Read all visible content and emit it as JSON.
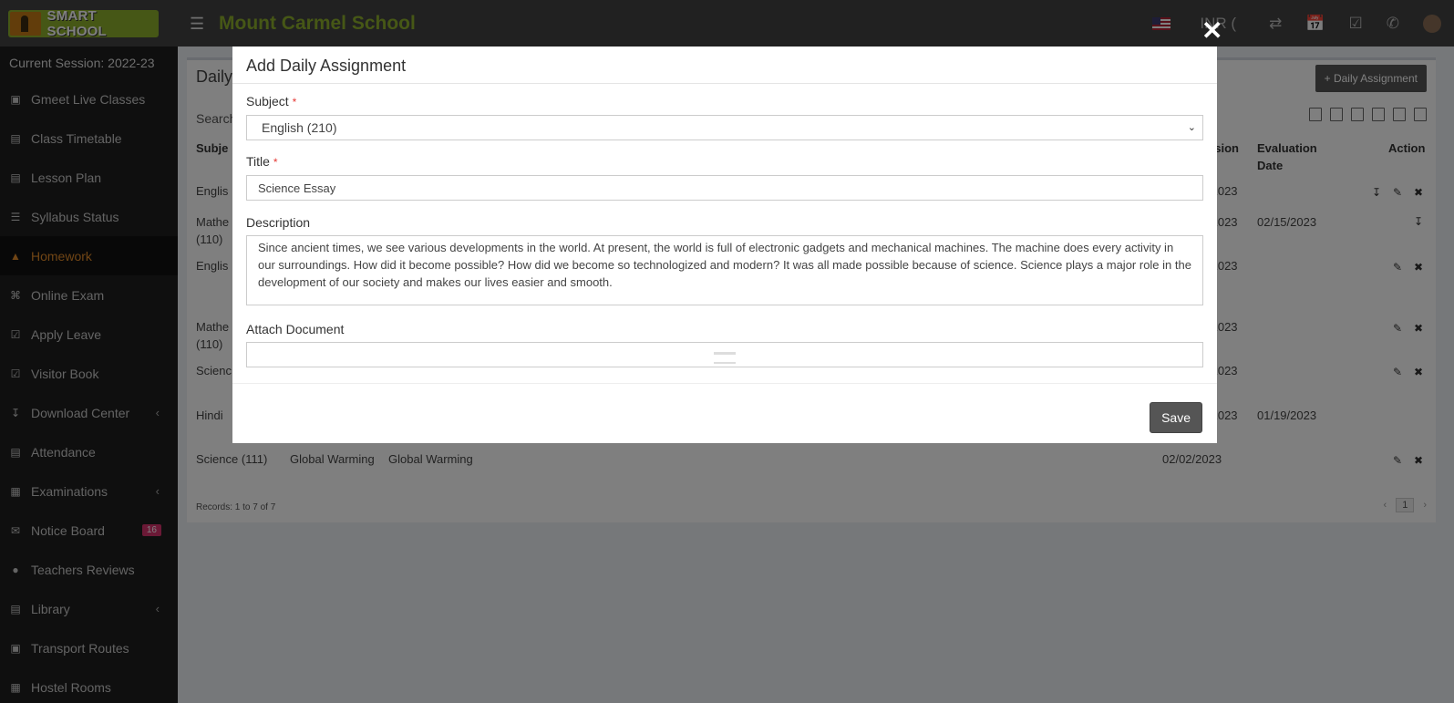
{
  "topbar": {
    "logo_text": "SMART SCHOOL",
    "school_name": "Mount Carmel School",
    "currency": "INR (",
    "icons": [
      "menu-icon",
      "flag-icon",
      "exchange-icon",
      "calendar-icon",
      "check-square-icon",
      "whatsapp-icon",
      "avatar-icon"
    ]
  },
  "sidebar": {
    "session": "Current Session: 2022-23",
    "items": [
      {
        "label": "Gmeet Live Classes",
        "icon": "video-icon"
      },
      {
        "label": "Class Timetable",
        "icon": "calendar-plus-icon"
      },
      {
        "label": "Lesson Plan",
        "icon": "list-alt-icon"
      },
      {
        "label": "Syllabus Status",
        "icon": "list-icon"
      },
      {
        "label": "Homework",
        "icon": "flask-icon"
      },
      {
        "label": "Online Exam",
        "icon": "rss-icon"
      },
      {
        "label": "Apply Leave",
        "icon": "check-square-icon"
      },
      {
        "label": "Visitor Book",
        "icon": "check-square-icon"
      },
      {
        "label": "Download Center",
        "icon": "download-icon"
      },
      {
        "label": "Attendance",
        "icon": "calendar-check-icon"
      },
      {
        "label": "Examinations",
        "icon": "map-icon"
      },
      {
        "label": "Notice Board",
        "icon": "envelope-icon",
        "badge": "16"
      },
      {
        "label": "Teachers Reviews",
        "icon": "user-secret-icon"
      },
      {
        "label": "Library",
        "icon": "book-icon"
      },
      {
        "label": "Transport Routes",
        "icon": "bus-icon"
      },
      {
        "label": "Hostel Rooms",
        "icon": "building-icon"
      }
    ],
    "active_index": 4
  },
  "page": {
    "title": "Daily",
    "add_button": "+ Daily Assignment",
    "search_label": "Search",
    "headers": {
      "subject": "Subje",
      "submission": "ssion",
      "evaluation": "Evaluation",
      "evaluation2": "Date",
      "action": "Action"
    },
    "rows": [
      {
        "subject": "Englis",
        "date": "/2023",
        "eval": ""
      },
      {
        "subject": "Mathe",
        "subject2": "(110)",
        "date": "/2023",
        "eval": "02/15/2023"
      },
      {
        "subject": "Englis",
        "date": "/2023",
        "eval": ""
      },
      {
        "subject": "Mathe",
        "subject2": "(110)",
        "date": "/2023",
        "eval": ""
      },
      {
        "subject": "Scienc",
        "date": "/2023",
        "eval": ""
      },
      {
        "subject": "Hindi",
        "date": "/2023",
        "eval": "01/19/2023"
      },
      {
        "subject": "Science (111)",
        "title": "Global Warming",
        "description": "Global Warming",
        "date": "02/02/2023",
        "eval": ""
      }
    ],
    "records": "Records: 1 to 7 of 7",
    "page_num": "1"
  },
  "modal": {
    "title": "Add Daily Assignment",
    "subject_label": "Subject",
    "subject_value": "English (210)",
    "title_label": "Title",
    "title_value": "Science Essay",
    "description_label": "Description",
    "description_value": "Since ancient times, we see various developments in the world. At present, the world is full of electronic gadgets and mechanical machines. The machine does every activity in our surroundings. How did it become possible? How did we become so technologized and modern? It was all made possible because of science. Science plays a major role in the development of our society and makes our lives easier and smooth.",
    "attach_label": "Attach Document",
    "required_mark": "*",
    "save_label": "Save",
    "close_symbol": "✕"
  }
}
